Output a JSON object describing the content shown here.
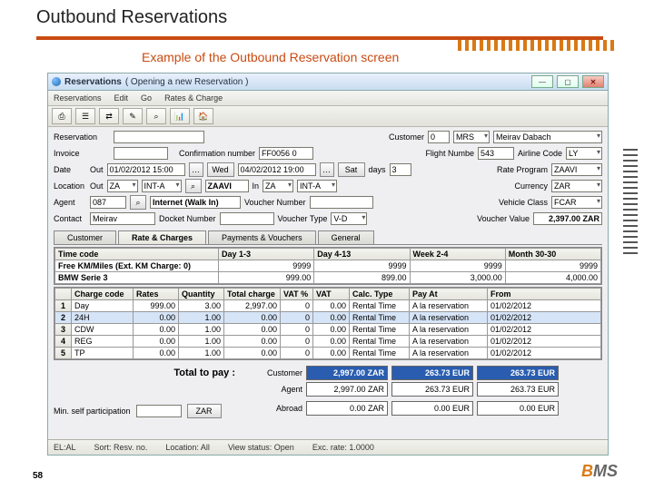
{
  "slide": {
    "title": "Outbound Reservations",
    "subtitle": "Example of the Outbound Reservation screen",
    "page": "58",
    "logo_prefix": "B",
    "logo_rest": "MS"
  },
  "window": {
    "title": "Reservations",
    "subtitle": "( Opening a new Reservation )"
  },
  "menu": [
    "Reservations",
    "Edit",
    "Go",
    "Rates & Charge"
  ],
  "toolbar_icons": [
    "⎙",
    "☰",
    "⇄",
    "✎",
    "⌕",
    "📊",
    "🏠"
  ],
  "labels": {
    "reservation": "Reservation",
    "customer": "Customer",
    "invoice": "Invoice",
    "confirmation": "Confirmation number",
    "flight": "Flight Numbe",
    "airline": "Airline Code",
    "date": "Date",
    "out": "Out",
    "in": "In",
    "days": "days",
    "rateprog": "Rate Program",
    "location": "Location",
    "currency": "Currency",
    "agent": "Agent",
    "agent_name": "Internet (Walk In)",
    "voucher_no": "Voucher Number",
    "vehicle": "Vehicle Class",
    "contact": "Contact",
    "docket": "Docket Number",
    "voucher_type": "Voucher Type",
    "voucher_value": "Voucher Value",
    "tab_customer": "Customer",
    "tab_rate": "Rate & Charges",
    "tab_pay": "Payments & Vouchers",
    "tab_general": "General",
    "total": "Total to pay :",
    "tot_customer": "Customer",
    "tot_agent": "Agent",
    "tot_abroad": "Abroad",
    "minself": "Min. self participation",
    "minself_cur": "ZAR"
  },
  "fields": {
    "cust_no": "0",
    "cust_title": "MRS",
    "cust_name": "Meirav Dabach",
    "conf_no": "FF0056 0",
    "flight_no": "543",
    "airline": "LY",
    "date_out": "01/02/2012  15:00",
    "dow_out": "Wed",
    "date_in": "04/02/2012  19:00",
    "dow_in": "Sat",
    "days": "3",
    "rateprog": "ZAAVI",
    "loc_out": "ZA",
    "loc_out2": "INT-A",
    "loc_name": "ZAAVI",
    "loc_in": "ZA",
    "loc_in2": "INT-A",
    "currency": "ZAR",
    "agent": "087",
    "vehicle": "FCAR",
    "contact": "Meirav",
    "voucher_type": "V-D",
    "voucher_value": "2,397.00 ZAR"
  },
  "rate_table": {
    "headers": [
      "Time code",
      "Day 1-3",
      "Day 4-13",
      "Week 2-4",
      "Month 30-30"
    ],
    "rows": [
      [
        "Free KM/Miles (Ext. KM Charge: 0)",
        "9999",
        "9999",
        "9999",
        "9999"
      ],
      [
        "BMW Serie 3",
        "999.00",
        "899.00",
        "3,000.00",
        "4,000.00"
      ]
    ]
  },
  "charge_table": {
    "headers": [
      "",
      "Charge code",
      "Rates",
      "Quantity",
      "Total charge",
      "VAT %",
      "VAT",
      "Calc. Type",
      "Pay At",
      "From"
    ],
    "rows": [
      [
        "1",
        "Day",
        "999.00",
        "3.00",
        "2,997.00",
        "0",
        "0.00",
        "Rental Time",
        "A la reservation",
        "01/02/2012"
      ],
      [
        "2",
        "24H",
        "0.00",
        "1.00",
        "0.00",
        "0",
        "0.00",
        "Rental Time",
        "A la reservation",
        "01/02/2012"
      ],
      [
        "3",
        "CDW",
        "0.00",
        "1.00",
        "0.00",
        "0",
        "0.00",
        "Rental Time",
        "A la reservation",
        "01/02/2012"
      ],
      [
        "4",
        "REG",
        "0.00",
        "1.00",
        "0.00",
        "0",
        "0.00",
        "Rental Time",
        "A la reservation",
        "01/02/2012"
      ],
      [
        "5",
        "TP",
        "0.00",
        "1.00",
        "0.00",
        "0",
        "0.00",
        "Rental Time",
        "A la reservation",
        "01/02/2012"
      ]
    ],
    "selected": 1
  },
  "totals": {
    "customer": [
      "2,997.00 ZAR",
      "263.73 EUR",
      "263.73 EUR"
    ],
    "agent": [
      "2,997.00 ZAR",
      "263.73 EUR",
      "263.73 EUR"
    ],
    "abroad": [
      "0.00 ZAR",
      "0.00 EUR",
      "0.00 EUR"
    ]
  },
  "status": {
    "el": "EL:AL",
    "sort": "Sort: Resv. no.",
    "loc": "Location: All",
    "view": "View status: Open",
    "rate": "Exc. rate: 1.0000"
  }
}
